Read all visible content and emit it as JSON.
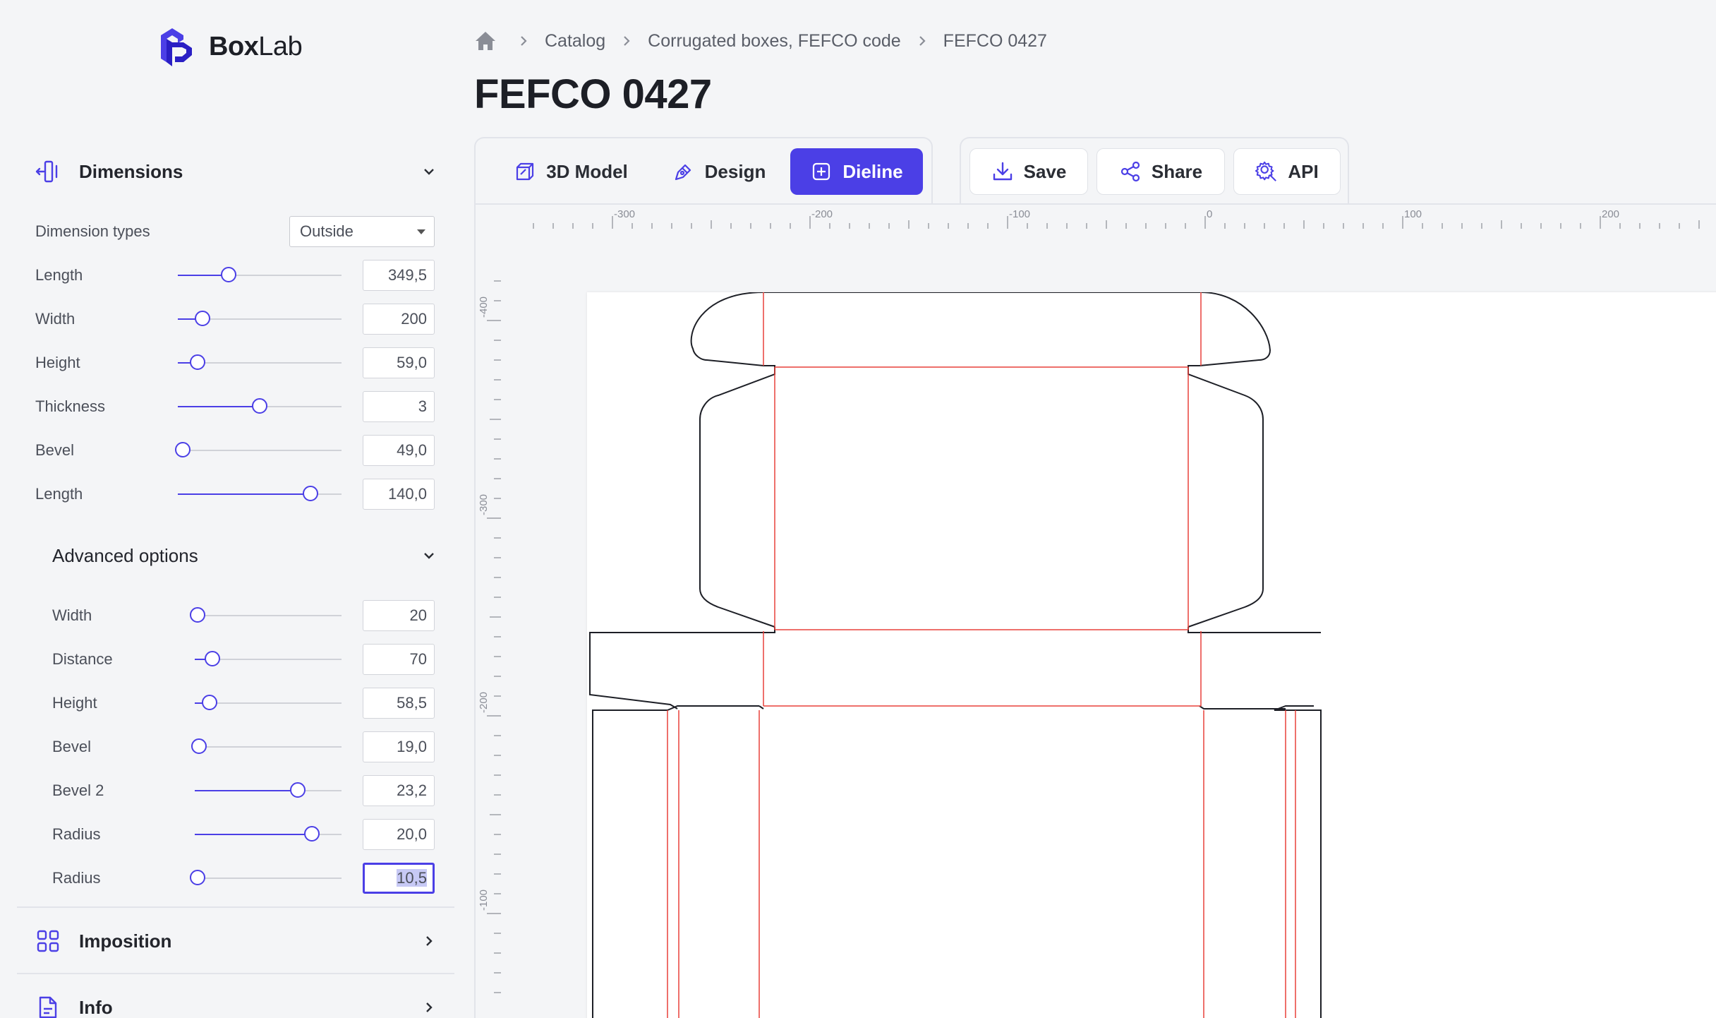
{
  "app": {
    "brand": {
      "bold": "Box",
      "light": "Lab"
    }
  },
  "colors": {
    "accent": "#4b3fe6",
    "cut_line": "#1d1f26",
    "fold_line": "#e8403a"
  },
  "sidebar": {
    "dimensions": {
      "title": "Dimensions",
      "dimension_types_label": "Dimension types",
      "dimension_types_value": "Outside",
      "fields": [
        {
          "label": "Length",
          "value": "349,5",
          "level": 0.31
        },
        {
          "label": "Width",
          "value": "200",
          "level": 0.15
        },
        {
          "label": "Height",
          "value": "59,0",
          "level": 0.12
        },
        {
          "label": "Thickness",
          "value": "3",
          "level": 0.5
        },
        {
          "label": "Bevel",
          "value": "49,0",
          "level": 0.03
        },
        {
          "label": "Length",
          "value": "140,0",
          "level": 0.81
        }
      ]
    },
    "advanced": {
      "title": "Advanced options",
      "fields": [
        {
          "label": "Width",
          "value": "20",
          "level": 0.02
        },
        {
          "label": "Distance",
          "value": "70",
          "level": 0.12
        },
        {
          "label": "Height",
          "value": "58,5",
          "level": 0.1
        },
        {
          "label": "Bevel",
          "value": "19,0",
          "level": 0.03
        },
        {
          "label": "Bevel 2",
          "value": "23,2",
          "level": 0.7
        },
        {
          "label": "Radius",
          "value": "20,0",
          "level": 0.8
        },
        {
          "label": "Radius",
          "value": "10,5",
          "level": 0.02
        }
      ]
    },
    "imposition": {
      "title": "Imposition"
    },
    "info": {
      "title": "Info"
    }
  },
  "breadcrumb": {
    "items": [
      "Catalog",
      "Corrugated boxes, FEFCO code",
      "FEFCO 0427"
    ]
  },
  "page": {
    "title": "FEFCO 0427"
  },
  "toolbar": {
    "view_tabs": [
      {
        "label": "3D Model",
        "icon": "cube-icon",
        "active": false
      },
      {
        "label": "Design",
        "icon": "pen-icon",
        "active": false
      },
      {
        "label": "Dieline",
        "icon": "dieline-icon",
        "active": true
      }
    ],
    "actions": [
      {
        "label": "Save",
        "icon": "download-icon"
      },
      {
        "label": "Share",
        "icon": "share-icon"
      },
      {
        "label": "API",
        "icon": "api-icon"
      }
    ]
  },
  "ruler": {
    "x_labels": [
      "-300",
      "-200",
      "-100",
      "0",
      "100",
      "200"
    ],
    "y_labels": [
      "-400",
      "-300",
      "-200",
      "-100"
    ]
  }
}
